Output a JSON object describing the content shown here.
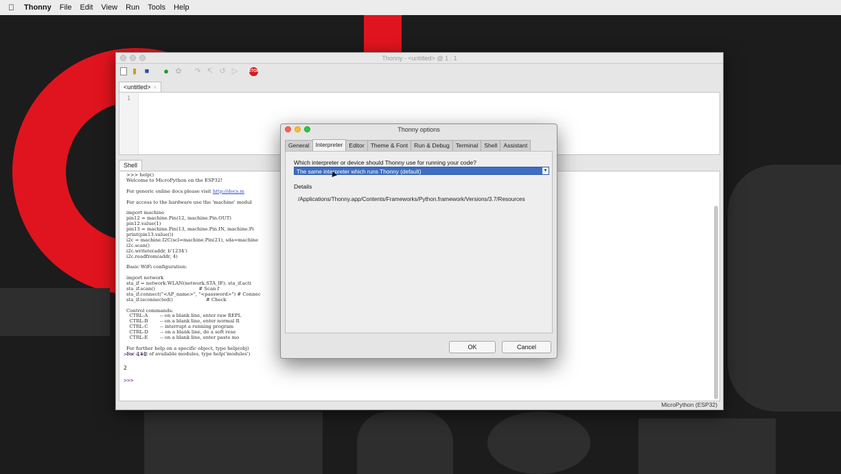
{
  "menubar": {
    "apple_icon": "apple-icon",
    "items": [
      "Thonny",
      "File",
      "Edit",
      "View",
      "Run",
      "Tools",
      "Help"
    ]
  },
  "main_window": {
    "title": "Thonny - <untitled> @ 1 : 1",
    "toolbar_icons": [
      "new-file-icon",
      "open-file-icon",
      "save-icon",
      "run-icon",
      "debug-icon",
      "step-over-icon",
      "step-into-icon",
      "step-out-icon",
      "resume-icon",
      "stop-icon"
    ],
    "editor_tab": "<untitled>",
    "editor_line_number": "1",
    "shell_tab": "Shell",
    "shell_lines": [
      ">>> help()",
      "Welcome to MicroPython on the ESP32!",
      "",
      "For generic online docs please visit http://docs.m",
      "",
      "For access to the hardware use the 'machine' modul",
      "",
      "import machine",
      "pin12 = machine.Pin(12, machine.Pin.OUT)",
      "pin12.value(1)",
      "pin13 = machine.Pin(13, machine.Pin.IN, machine.Pi",
      "print(pin13.value())",
      "i2c = machine.I2C(scl=machine.Pin(21), sda=machine",
      "i2c.scan()",
      "i2c.writeto(addr, b'1234')",
      "i2c.readfrom(addr, 4)",
      "",
      "Basic WiFi configuration:",
      "",
      "import network",
      "sta_if = network.WLAN(network.STA_IF); sta_if.acti",
      "sta_if.scan()                             # Scan f",
      "sta_if.connect(\"<AP_name>\", \"<password>\") # Connec",
      "sta_if.isconnected()                      # Check",
      "",
      "Control commands:",
      "  CTRL-A        -- on a blank line, enter raw REPL",
      "  CTRL-B        -- on a blank line, enter normal R",
      "  CTRL-C        -- interrupt a running program",
      "  CTRL-D        -- on a blank line, do a soft rese",
      "  CTRL-E        -- on a blank line, enter paste mo",
      "",
      "For further help on a specific object, type help(obj)",
      "For a list of available modules, type help('modules')"
    ],
    "shell_prompt_1": ">>>",
    "shell_input_1": "1+1",
    "shell_output_1": "2",
    "shell_prompt_2": ">>>",
    "status_text": "MicroPython (ESP32)"
  },
  "options_dialog": {
    "title": "Thonny options",
    "tabs": [
      "General",
      "Interpreter",
      "Editor",
      "Theme & Font",
      "Run & Debug",
      "Terminal",
      "Shell",
      "Assistant"
    ],
    "active_tab": "Interpreter",
    "question": "Which interpreter or device should Thonny use for running your code?",
    "selected_interpreter": "The same interpreter which runs Thonny (default)",
    "details_label": "Details",
    "details_path": "/Applications/Thonny.app/Contents/Frameworks/Python.framework/Versions/3.7/Resources",
    "ok_label": "OK",
    "cancel_label": "Cancel"
  },
  "colors": {
    "accent_selection": "#3d6ec4",
    "wallpaper_red": "#e0141e",
    "prompt_purple": "#7a2a9a"
  }
}
